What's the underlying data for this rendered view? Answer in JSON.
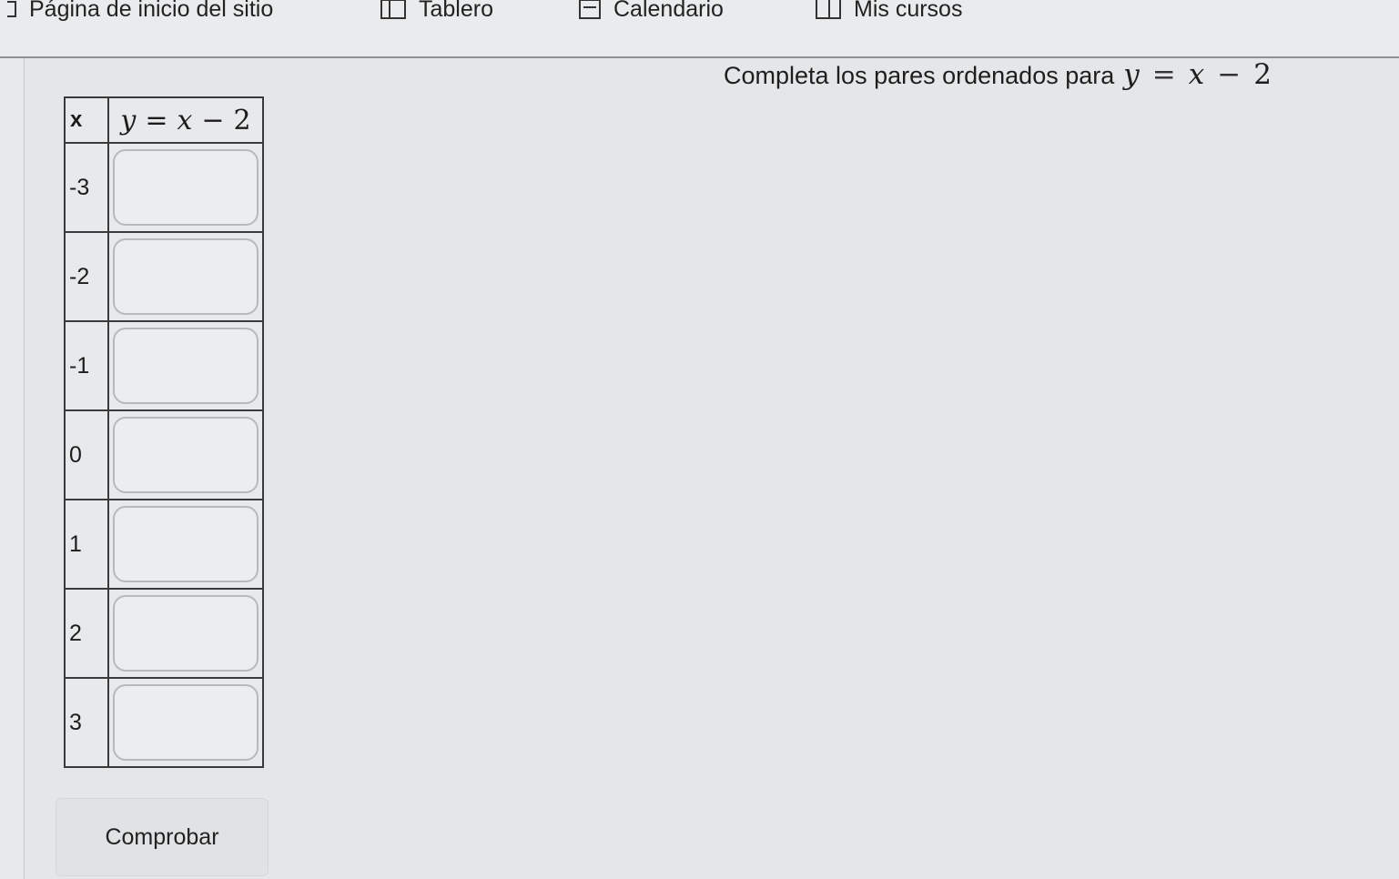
{
  "nav": {
    "home_label": "Página de inicio del sitio",
    "dashboard_label": "Tablero",
    "calendar_label": "Calendario",
    "courses_label": "Mis cursos"
  },
  "question": {
    "prompt": "Completa los pares ordenados para",
    "equation": {
      "lhs": "y",
      "op1": "=",
      "var": "x",
      "op2": "−",
      "const": "2"
    }
  },
  "table": {
    "header_x": "x",
    "header_y": {
      "lhs": "y",
      "op1": "=",
      "var": "x",
      "op2": "−",
      "const": "2"
    },
    "rows": [
      {
        "x": "-3",
        "y": ""
      },
      {
        "x": "-2",
        "y": ""
      },
      {
        "x": "-1",
        "y": ""
      },
      {
        "x": "0",
        "y": ""
      },
      {
        "x": "1",
        "y": ""
      },
      {
        "x": "2",
        "y": ""
      },
      {
        "x": "3",
        "y": ""
      }
    ]
  },
  "actions": {
    "check_label": "Comprobar"
  },
  "icons": {
    "home": "home-icon",
    "dashboard": "dashboard-icon",
    "calendar": "calendar-icon",
    "courses": "book-icon"
  }
}
